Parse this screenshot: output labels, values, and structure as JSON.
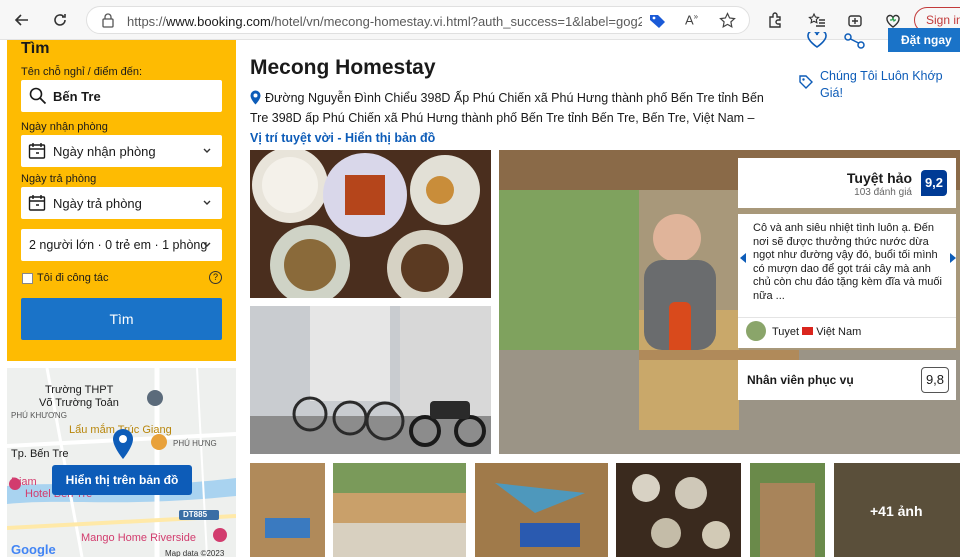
{
  "browser": {
    "url_prefix": "https://",
    "url_host": "www.booking.com",
    "url_path": "/hotel/vn/mecong-homestay.vi.html?auth_success=1&label=gog23...",
    "signin_label": "Sign in"
  },
  "search": {
    "title": "Tìm",
    "destination_label": "Tên chỗ nghỉ / điểm đến:",
    "destination_value": "Bến Tre",
    "checkin_label": "Ngày nhận phòng",
    "checkin_value": "Ngày nhận phòng",
    "checkout_label": "Ngày trả phòng",
    "checkout_value": "Ngày trả phòng",
    "guests_value": "2 người lớn · 0 trẻ em · 1 phòng",
    "business_label": "Tôi đi công tác",
    "submit_label": "Tìm"
  },
  "map": {
    "labels": [
      "Trường THPT",
      "Võ Trường Toản",
      "PHÚ KHƯƠNG",
      "Lẩu mắm Trúc Giang",
      "PHÚ HƯNG",
      "Tp. Bến Tre",
      "Diam",
      "Hotel Bến Tre",
      "DT885",
      "Mango Home Riverside"
    ],
    "show_map_label": "Hiển thị trên bản đồ",
    "google": "Google",
    "map_data": "Map data ©2023"
  },
  "hotel": {
    "name": "Mecong Homestay",
    "address": "Đường Nguyễn Đình Chiểu 398D Ấp Phú Chiến xã Phú Hưng thành phố Bến Tre tỉnh Bến Tre 398D ấp Phú Chiến xã Phú Hưng thành phố Bến Tre tỉnh Bến Tre, Bến Tre, Việt Nam –",
    "location_link": "Vị trí tuyệt vời - Hiển thị bản đồ",
    "top_button": "Đặt ngay",
    "price_promo": "Chúng Tôi Luôn Khớp Giá!"
  },
  "rating": {
    "label": "Tuyệt hảo",
    "count": "103 đánh giá",
    "score": "9,2"
  },
  "review": {
    "text": "Cô và anh siêu nhiệt tình luôn ạ. Đến nơi sẽ được thưởng thức nước dừa ngọt như đường vậy đó, buổi tối mình có mượn dao để gọt trái cây mà anh chủ còn chu đáo tặng kèm đĩa và muối nữa ...",
    "author": "Tuyet",
    "country": "Việt Nam"
  },
  "staff": {
    "label": "Nhân viên phục vụ",
    "score": "9,8"
  },
  "gallery": {
    "more_photos": "+41 ảnh"
  },
  "colors": {
    "booking_yellow": "#febb02",
    "booking_blue": "#0d5cb8",
    "score_blue": "#003b95"
  }
}
